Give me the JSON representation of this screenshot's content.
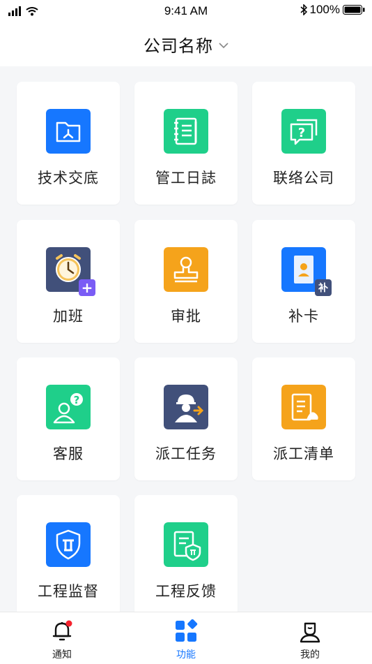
{
  "status_bar": {
    "time": "9:41 AM",
    "battery": "100%"
  },
  "header": {
    "title": "公司名称"
  },
  "colors": {
    "blue": "#1677ff",
    "green": "#1fcf8a",
    "navy": "#41507a",
    "orange": "#f5a31b",
    "red": "#f5222d"
  },
  "functions": [
    {
      "label": "技术交底",
      "icon": "folder-share-icon"
    },
    {
      "label": "管工日誌",
      "icon": "notebook-icon"
    },
    {
      "label": "联络公司",
      "icon": "chat-question-icon"
    },
    {
      "label": "加班",
      "icon": "alarm-clock-add-icon"
    },
    {
      "label": "审批",
      "icon": "stamp-icon"
    },
    {
      "label": "补卡",
      "icon": "id-card-icon"
    },
    {
      "label": "客服",
      "icon": "customer-service-icon"
    },
    {
      "label": "派工任务",
      "icon": "worker-dispatch-icon"
    },
    {
      "label": "派工清单",
      "icon": "dispatch-list-icon"
    },
    {
      "label": "工程监督",
      "icon": "shield-icon"
    },
    {
      "label": "工程反馈",
      "icon": "document-shield-icon"
    }
  ],
  "tabbar": [
    {
      "label": "通知",
      "icon": "bell-icon"
    },
    {
      "label": "功能",
      "icon": "apps-icon"
    },
    {
      "label": "我的",
      "icon": "user-icon"
    }
  ],
  "icon_badges": {
    "overtime": "+",
    "card": "补"
  }
}
